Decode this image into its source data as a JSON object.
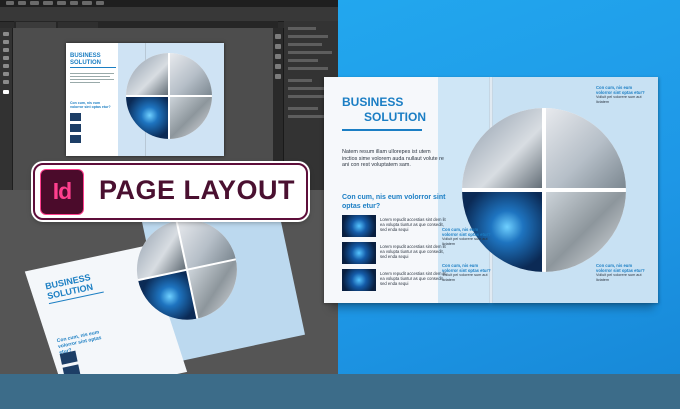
{
  "badge": {
    "app_logo_text": "Id",
    "label": "PAGE LAYOUT",
    "logo_color": "#ff3f8e",
    "text_color": "#4a1030"
  },
  "brochure": {
    "title_line1": "BUSINESS",
    "title_line2": "SOLUTION",
    "intro_text": "Natem resum illam ullorepes ist utem inctios sime volorem auda nullaut volute re ani con rest voluptatem sam.",
    "subheading": "Con cum, nis eum volorror sint optas etur?",
    "items": [
      {
        "text": "Lorem repudit accestias sint dem lit ea volupta tiuntur as que consedit, sed enda sequi"
      },
      {
        "text": "Lorem repudit accestias sint dem lit ea volupta tiuntur as que consedit, sed enda sequi"
      },
      {
        "text": "Lorem repudit accestias sint dem lit ea volupta tiuntur as que consedit, sed enda sequi"
      }
    ],
    "notes": [
      {
        "heading": "Con cum, nis eum volorror sint optas etur?",
        "body": "Volluit pel volorere sum aut lictatem"
      },
      {
        "heading": "Con cum, nis eum volorror sint optas etur?",
        "body": "Volluit pel volorere sum aut lictatem"
      },
      {
        "heading": "Con cum, nis eum volorror sint optas etur?",
        "body": "Volluit pel volorere sum aut lictatem"
      },
      {
        "heading": "Con cum, nis eum volorror sint optas etur?",
        "body": "Volluit pel volorere sum aut lictatem"
      }
    ],
    "accent_color": "#1b7ec4"
  },
  "colors": {
    "background_blue": "#1e97e6",
    "workspace": "#2c2c2c",
    "bottom_bar": "#3c6c89"
  }
}
